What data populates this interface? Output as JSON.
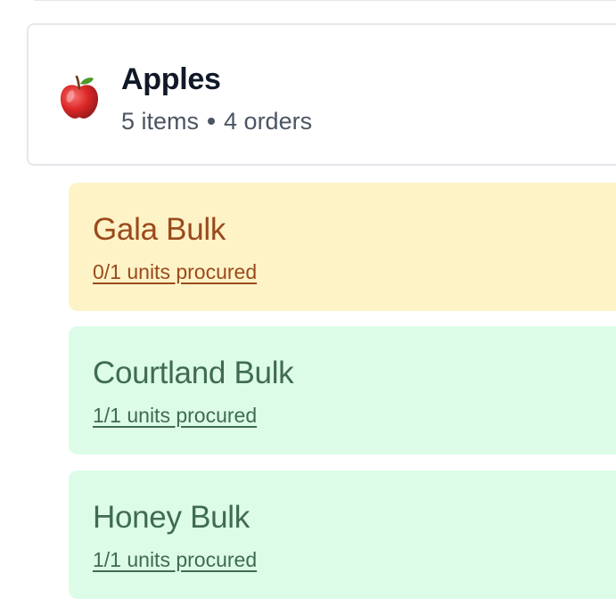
{
  "group": {
    "icon": "red-apple-icon",
    "title": "Apples",
    "item_count": "5 items",
    "order_count": "4 orders"
  },
  "items": [
    {
      "name": "Gala Bulk",
      "status": "0/1 units procured",
      "state": "pending",
      "procured": 0,
      "required": 1
    },
    {
      "name": "Courtland Bulk",
      "status": "1/1 units procured",
      "state": "complete",
      "procured": 1,
      "required": 1
    },
    {
      "name": "Honey Bulk",
      "status": "1/1 units procured",
      "state": "complete",
      "procured": 1,
      "required": 1
    }
  ],
  "colors": {
    "pending_bg": "#fef3c6",
    "pending_text": "#9a4a1d",
    "complete_bg": "#dcfce7",
    "complete_text": "#3f6b52"
  }
}
